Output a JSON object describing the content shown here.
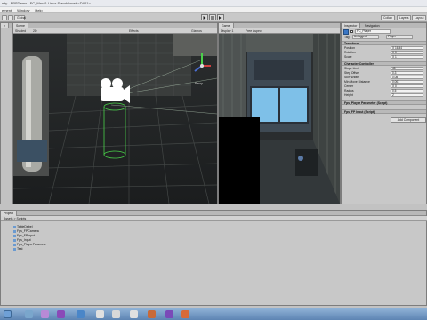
{
  "window": {
    "title": "nity - FPSDemo - FC_Mac & Linux Standalone* <DX11>"
  },
  "menu": [
    "ement",
    "Window",
    "Help"
  ],
  "toolbar": {
    "pivot_label": "Global",
    "play_icon": "play-icon",
    "pause_icon": "pause-icon",
    "step_icon": "step-icon",
    "collab_label": "Collab",
    "layers_label": "Layers",
    "layout_label": "Layout"
  },
  "hierarchy": {
    "tab_label": "y"
  },
  "scene": {
    "tab_label": "Scene",
    "subbar": [
      "Shaded",
      "2D",
      "Effects",
      "Gizmos"
    ],
    "camera_gizmo_icon": "camera-icon",
    "axis_label": "Persp"
  },
  "game": {
    "tab_label": "Game",
    "subbar": [
      "Display 1",
      "Free Aspect"
    ]
  },
  "inspector": {
    "tab_inspector": "Inspector",
    "tab_navigation": "Navigation",
    "object_name": "FC_Player",
    "tag_label": "Tag",
    "tag_value": "Untagged",
    "layer_value": "Player",
    "transform": {
      "header": "Transform",
      "rows": [
        {
          "label": "Position",
          "value": "X 16.44"
        },
        {
          "label": "Rotation",
          "value": "X 0"
        },
        {
          "label": "Scale",
          "value": "X 1"
        }
      ]
    },
    "character_controller": {
      "header": "Character Controller",
      "rows": [
        {
          "label": "Slope Limit",
          "value": "45"
        },
        {
          "label": "Step Offset",
          "value": "0.3"
        },
        {
          "label": "Skin Width",
          "value": "0.08"
        },
        {
          "label": "Min Move Distance",
          "value": "0.001"
        },
        {
          "label": "Center",
          "value": "X 0"
        },
        {
          "label": "Radius",
          "value": "0.5"
        },
        {
          "label": "Height",
          "value": "2"
        }
      ]
    },
    "scripts": [
      "Fps_Player Parameter (Script)",
      "Fps_FP Input (Script)"
    ],
    "add_component_label": "Add Component"
  },
  "project": {
    "tab_label": "Project",
    "breadcrumb": "Assets > Scripts",
    "files": [
      "TableDebel",
      "Fps_FPCamera",
      "Fps_FPInput",
      "Fps_Input",
      "Fps_PlayerParamete",
      "Test"
    ]
  },
  "taskbar": {
    "icons": [
      "explorer-icon",
      "terminal-icon",
      "visual-studio-icon",
      "media-icon",
      "unity-icon",
      "unity-icon-2",
      "unity-icon-3",
      "vs-code-icon",
      "visual-studio-icon-2",
      "app-icon"
    ]
  },
  "colors": {
    "panel": "#c2c2c2",
    "scene_bg": "#232628",
    "gizmo_green": "#49d049",
    "highlight_blue": "#6a9ad0"
  }
}
